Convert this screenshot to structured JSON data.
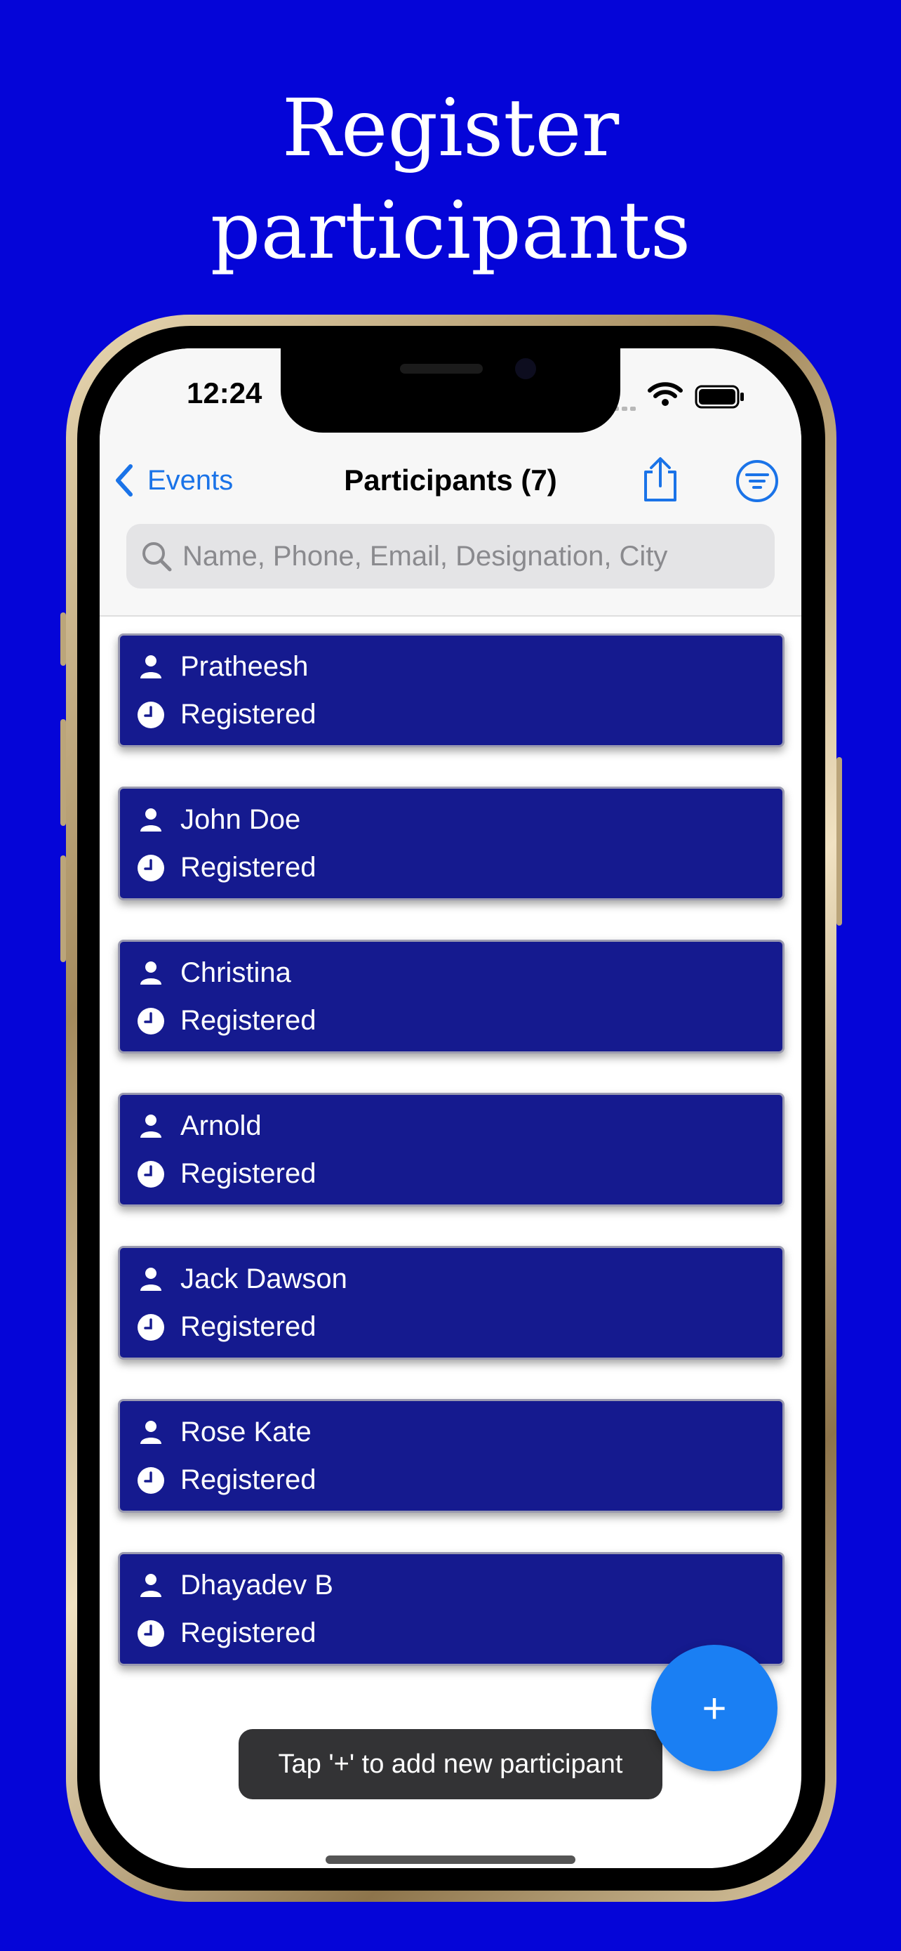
{
  "promo": {
    "headline_line1": "Register",
    "headline_line2": "participants"
  },
  "status_bar": {
    "time": "12:24"
  },
  "nav": {
    "back_label": "Events",
    "title": "Participants (7)"
  },
  "search": {
    "placeholder": "Name, Phone, Email, Designation, City"
  },
  "participants": [
    {
      "name": "Pratheesh",
      "status": "Registered"
    },
    {
      "name": "John Doe",
      "status": "Registered"
    },
    {
      "name": "Christina",
      "status": "Registered"
    },
    {
      "name": "Arnold",
      "status": "Registered"
    },
    {
      "name": "Jack Dawson",
      "status": "Registered"
    },
    {
      "name": "Rose Kate",
      "status": "Registered"
    },
    {
      "name": "Dhayadev B",
      "status": "Registered"
    }
  ],
  "fab": {
    "label": "+"
  },
  "toast": {
    "text": "Tap '+' to add new participant"
  },
  "colors": {
    "background": "#0505d8",
    "card": "#151a8f",
    "accent": "#1a73e8",
    "fab": "#1a7ff3"
  },
  "icons": {
    "back": "chevron-left-icon",
    "share": "share-icon",
    "filter": "filter-icon",
    "search": "search-icon",
    "person": "person-icon",
    "status": "clock-icon"
  }
}
